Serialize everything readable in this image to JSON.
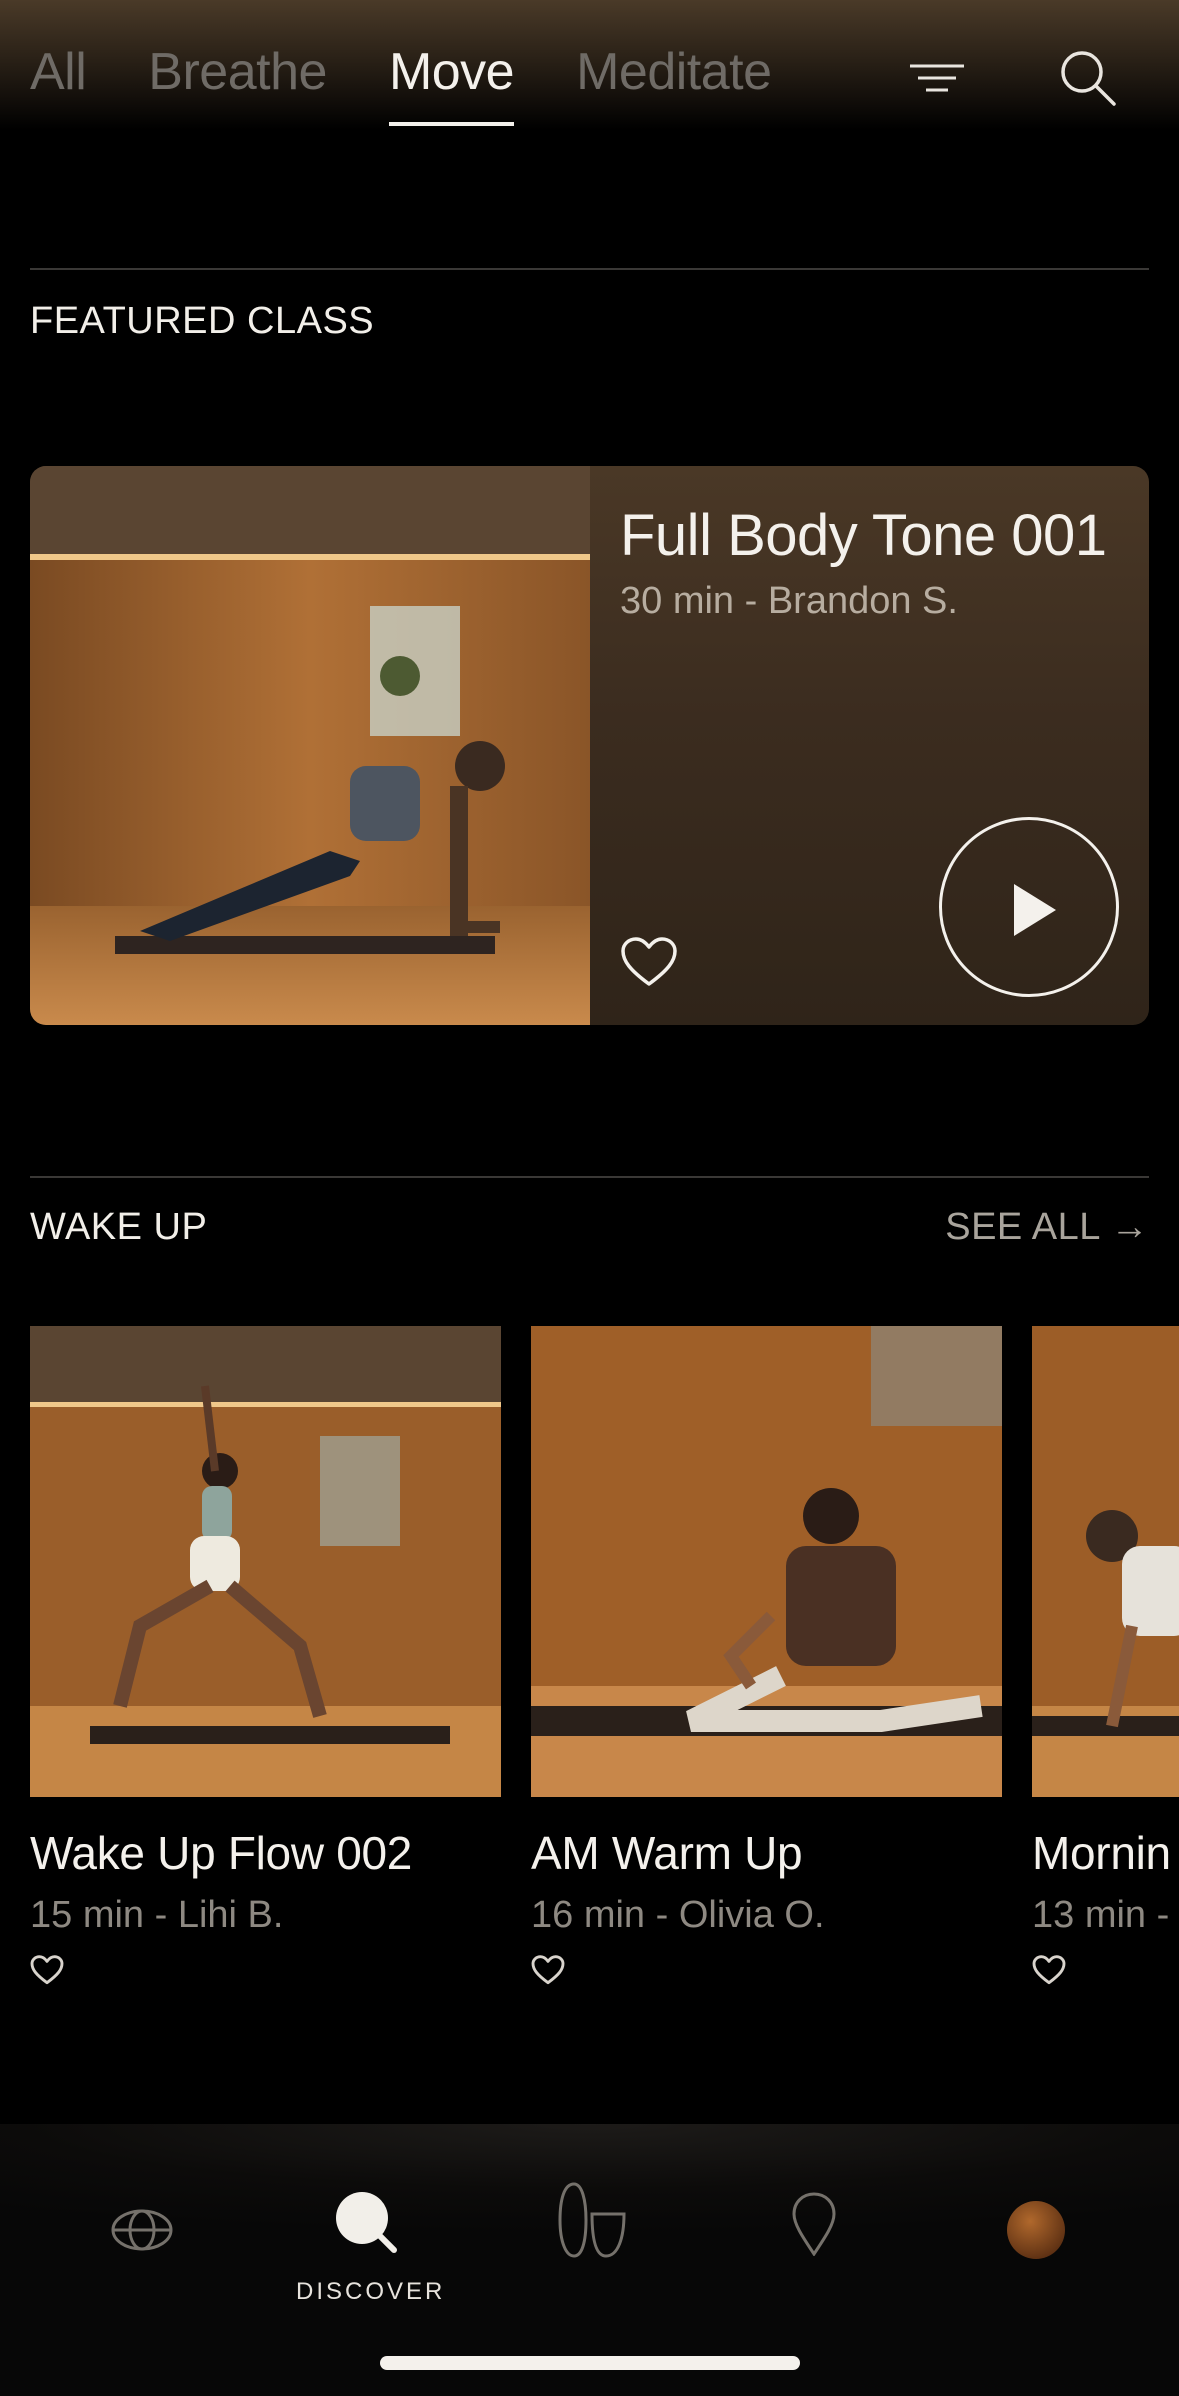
{
  "top_tabs": [
    {
      "label": "All",
      "active": false
    },
    {
      "label": "Breathe",
      "active": false
    },
    {
      "label": "Move",
      "active": true
    },
    {
      "label": "Meditate",
      "active": false
    }
  ],
  "icons": {
    "filter": "filter-lines-icon",
    "search": "search-icon",
    "favorite": "heart-icon",
    "play": "play-icon"
  },
  "featured": {
    "section_title": "FEATURED CLASS",
    "title": "Full Body Tone 001",
    "meta": "30 min - Brandon S."
  },
  "wake_up": {
    "section_title": "WAKE UP",
    "see_all": "SEE ALL →",
    "cards": [
      {
        "title": "Wake Up Flow 002",
        "meta": "15 min - Lihi B."
      },
      {
        "title": "AM Warm Up",
        "meta": "16 min - Olivia O."
      },
      {
        "title": "Mornin",
        "meta": "13 min -"
      }
    ]
  },
  "bottom_nav": {
    "items": [
      {
        "icon": "globe-icon",
        "label": ""
      },
      {
        "icon": "discover-icon",
        "label": "DISCOVER",
        "active": true
      },
      {
        "icon": "feet-icon",
        "label": ""
      },
      {
        "icon": "pin-icon",
        "label": ""
      },
      {
        "icon": "profile-avatar",
        "label": ""
      }
    ]
  },
  "colors": {
    "background": "#000000",
    "text_primary": "#f4f1ec",
    "text_muted": "#6f6b66",
    "card_brown": "#3b2c1f"
  }
}
